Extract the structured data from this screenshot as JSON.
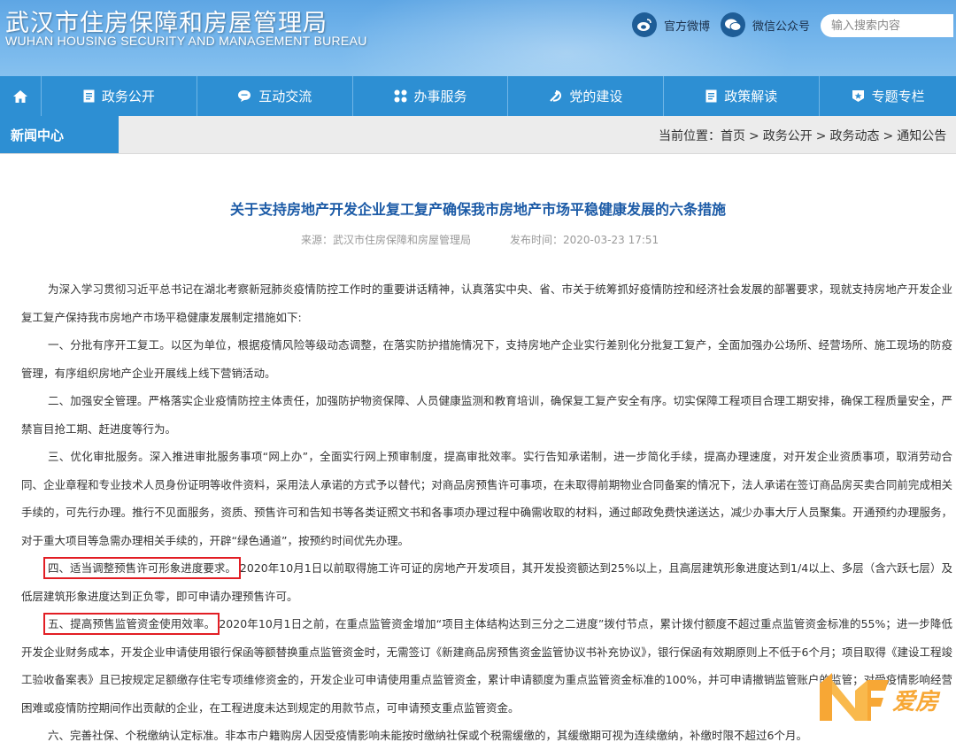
{
  "header": {
    "title_cn": "武汉市住房保障和房屋管理局",
    "title_en": "WUHAN HOUSING SECURITY AND MANAGEMENT BUREAU",
    "weibo_label": "官方微博",
    "wechat_label": "微信公众号",
    "search_placeholder": "输入搜索内容"
  },
  "nav": {
    "items": [
      {
        "label": "政务公开",
        "icon": "document-icon"
      },
      {
        "label": "互动交流",
        "icon": "chat-icon"
      },
      {
        "label": "办事服务",
        "icon": "grid-icon"
      },
      {
        "label": "党的建设",
        "icon": "party-emblem-icon"
      },
      {
        "label": "政策解读",
        "icon": "document-icon"
      },
      {
        "label": "专题专栏",
        "icon": "badge-icon"
      }
    ]
  },
  "section": {
    "label": "新闻中心",
    "breadcrumb": [
      "当前位置：",
      "首页",
      ">",
      "政务公开",
      ">",
      "政务动态",
      ">",
      "通知公告"
    ]
  },
  "article": {
    "title": "关于支持房地产开发企业复工复产确保我市房地产市场平稳健康发展的六条措施",
    "source": "来源：武汉市住房保障和房屋管理局",
    "date": "发布时间：2020-03-23 17:51",
    "intro": "为深入学习贯彻习近平总书记在湖北考察新冠肺炎疫情防控工作时的重要讲话精神，认真落实中央、省、市关于统筹抓好疫情防控和经济社会发展的部署要求，现就支持房地产开发企业复工复产保持我市房地产市场平稳健康发展制定措施如下:",
    "p1": "一、分批有序开工复工。以区为单位，根据疫情风险等级动态调整，在落实防护措施情况下，支持房地产企业实行差别化分批复工复产，全面加强办公场所、经营场所、施工现场的防疫管理，有序组织房地产企业开展线上线下营销活动。",
    "p2": "二、加强安全管理。严格落实企业疫情防控主体责任，加强防护物资保障、人员健康监测和教育培训，确保复工复产安全有序。切实保障工程项目合理工期安排，确保工程质量安全，严禁盲目抢工期、赶进度等行为。",
    "p3": "三、优化审批服务。深入推进审批服务事项“网上办”，全面实行网上预审制度，提高审批效率。实行告知承诺制，进一步简化手续，提高办理速度，对开发企业资质事项，取消劳动合同、企业章程和专业技术人员身份证明等收件资料，采用法人承诺的方式予以替代；对商品房预售许可事项，在未取得前期物业合同备案的情况下，法人承诺在签订商品房买卖合同前完成相关手续的，可先行办理。推行不见面服务，资质、预售许可和告知书等各类证照文书和各事项办理过程中确需收取的材料，通过邮政免费快递送达，减少办事大厅人员聚集。开通预约办理服务，对于重大项目等急需办理相关手续的，开辟“绿色通道”，按预约时间优先办理。",
    "p4_head": "四、适当调整预售许可形象进度要求。",
    "p4_body": "2020年10月1日以前取得施工许可证的房地产开发项目，其开发投资额达到25%以上，且高层建筑形象进度达到1/4以上、多层（含六跃七层）及低层建筑形象进度达到正负零，即可申请办理预售许可。",
    "p5_head": "五、提高预售监管资金使用效率。",
    "p5_body": "2020年10月1日之前，在重点监管资金增加“项目主体结构达到三分之二进度”拨付节点，累计拨付额度不超过重点监管资金标准的55%；进一步降低开发企业财务成本，开发企业申请使用银行保函等额替换重点监管资金时，无需签订《新建商品房预售资金监管协议书补充协议》，银行保函有效期原则上不低于6个月；项目取得《建设工程竣工验收备案表》且已按规定足额缴存住宅专项维修资金的，开发企业可申请使用重点监管资金，累计申请额度为重点监管资金标准的100%，并可申请撤销监管账户的监管；对受疫情影响经营困难或疫情防控期间作出贡献的企业，在工程进度未达到规定的用款节点，可申请预支重点监管资金。",
    "p6": "六、完善社保、个税缴纳认定标准。非本市户籍购房人因受疫情影响未能按时缴纳社保或个税需缓缴的，其缓缴期可视为连续缴纳，补缴时限不超过6个月。"
  },
  "watermark": {
    "text": "爱房"
  },
  "colors": {
    "nav": "#2d8fd3",
    "title": "#1b5aa6",
    "highlight": "#e21e24"
  }
}
